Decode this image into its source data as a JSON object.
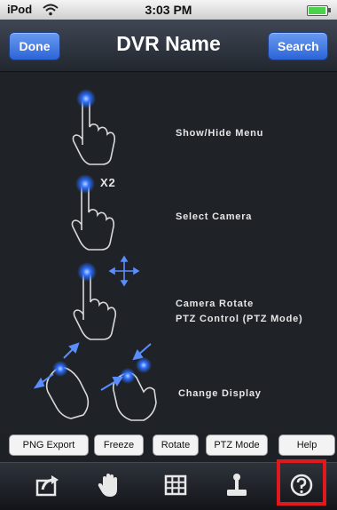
{
  "status_bar": {
    "carrier": "iPod",
    "time": "3:03 PM"
  },
  "nav": {
    "title": "DVR Name",
    "done_label": "Done",
    "search_label": "Search"
  },
  "help": {
    "items": [
      {
        "label": "Show/Hide Menu"
      },
      {
        "label": "Select Camera",
        "badge": "X2"
      },
      {
        "label_line1": "Camera Rotate",
        "label_line2": "PTZ Control (PTZ Mode)"
      },
      {
        "label": "Change Display"
      }
    ]
  },
  "tooltips": [
    "PNG Export",
    "Freeze",
    "Rotate",
    "PTZ Mode",
    "Help"
  ],
  "toolbar": {
    "buttons": [
      {
        "icon": "export-icon"
      },
      {
        "icon": "hand-icon"
      },
      {
        "icon": "grid-icon"
      },
      {
        "icon": "joystick-icon"
      },
      {
        "icon": "help-circle-icon"
      }
    ]
  },
  "colors": {
    "accent": "#3a73e0",
    "highlight": "#e0191f",
    "touch_dot": "#2a6cff"
  }
}
